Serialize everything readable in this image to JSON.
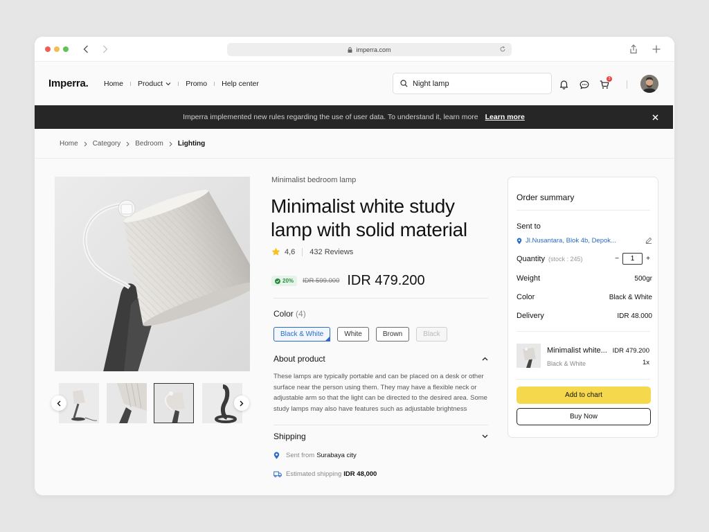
{
  "browser": {
    "url": "imperra.com"
  },
  "nav": {
    "logo": "Imperra.",
    "menu": [
      "Home",
      "Product",
      "Promo",
      "Help center"
    ],
    "search_value": "Night lamp",
    "cart_count": "3"
  },
  "banner": {
    "text": "Imperra implemented new rules regarding the use of user data. To understand it, learn more",
    "link": "Learn more"
  },
  "breadcrumb": [
    "Home",
    "Category",
    "Bedroom",
    "Lighting"
  ],
  "product": {
    "subtitle": "Minimalist bedroom lamp",
    "title": "Minimalist white study lamp with solid material",
    "rating": "4,6",
    "reviews": "432 Reviews",
    "discount": "20%",
    "old_price": "IDR 599.000",
    "price": "IDR 479.200",
    "color_label": "Color",
    "color_count": "(4)",
    "colors": [
      "Black & White",
      "White",
      "Brown",
      "Black"
    ],
    "selected_color": "Black & White",
    "disabled_color": "Black",
    "about_title": "About product",
    "about_text": "These lamps are typically portable and can be placed on a desk or other surface near the person using them. They may have a flexible neck or adjustable arm so that the light can be directed to the desired area. Some study lamps may also have features such as adjustable brightness",
    "shipping_title": "Shipping",
    "sent_from_label": "Sent from",
    "sent_from_city": "Surabaya city",
    "estimated_label": "Estimated shipping",
    "estimated_price": "IDR 48,000"
  },
  "order": {
    "title": "Order summary",
    "sent_to_label": "Sent to",
    "address": "Jl.Nusantara, Blok 4b, Depok...",
    "quantity_label": "Quantity",
    "stock": "(stock : 245)",
    "quantity": "1",
    "weight_label": "Weight",
    "weight": "500gr",
    "color_label": "Color",
    "color": "Black & White",
    "delivery_label": "Delivery",
    "delivery": "IDR 48.000",
    "item_name": "Minimalist white...",
    "item_price": "IDR 479.200",
    "item_variant": "Black & White",
    "item_qty": "1x",
    "add_button": "Add to chart",
    "buy_button": "Buy Now"
  },
  "colors": {
    "accent_yellow": "#f5d84b",
    "link_blue": "#2a6bc8",
    "banner_bg": "#262626",
    "discount_green": "#2d8a44",
    "badge_red": "#e94545"
  }
}
